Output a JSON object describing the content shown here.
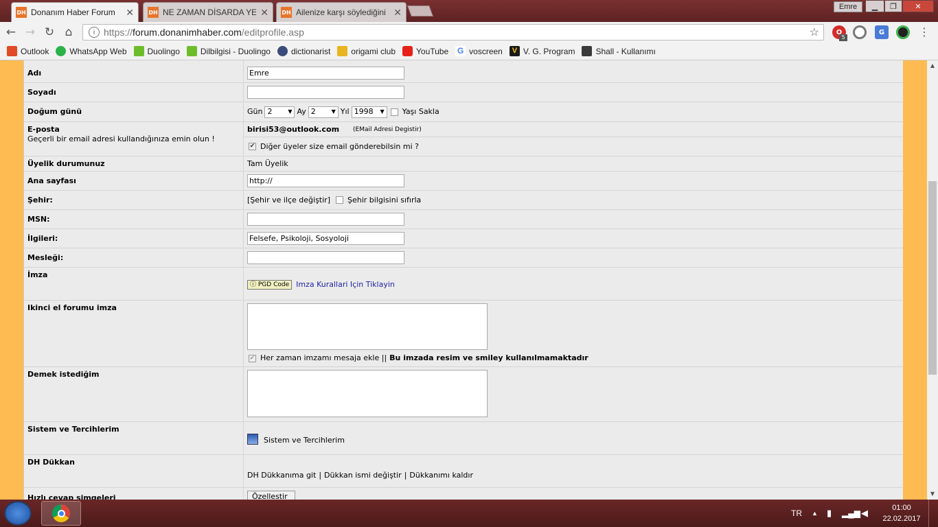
{
  "browser": {
    "tabs": [
      {
        "favicon": "DH",
        "title": "Donanım Haber Forum",
        "active": true
      },
      {
        "favicon": "DH",
        "title": "NE ZAMAN DİSARDA YE",
        "active": false
      },
      {
        "favicon": "DH",
        "title": "Ailenize karşı söylediğini",
        "active": false
      }
    ],
    "user_button": "Emre",
    "url": {
      "scheme": "https://",
      "host": "forum.donanimhaber.com",
      "path": "/editprofile.asp"
    },
    "extension_badge": "5",
    "bookmarks": [
      {
        "label": "Outlook",
        "icon": "windows-logo-icon",
        "color": "#e04a26"
      },
      {
        "label": "WhatsApp Web",
        "icon": "whatsapp-icon",
        "color": "#2bb34a"
      },
      {
        "label": "Duolingo",
        "icon": "duolingo-owl-icon",
        "color": "#6dbd2b"
      },
      {
        "label": "Dilbilgisi - Duolingo",
        "icon": "duolingo-owl-icon",
        "color": "#6dbd2b"
      },
      {
        "label": "dictionarist",
        "icon": "dictionarist-icon",
        "color": "#3b4c7a"
      },
      {
        "label": "origami club",
        "icon": "origami-crane-icon",
        "color": "#e8b520"
      },
      {
        "label": "YouTube",
        "icon": "youtube-icon",
        "color": "#e62117"
      },
      {
        "label": "voscreen",
        "icon": "google-g-icon",
        "color": "#4285f4"
      },
      {
        "label": "V. G. Program",
        "icon": "vg-program-icon",
        "color": "#1a1a1a"
      },
      {
        "label": "Shall - Kullanımı",
        "icon": "shall-page-icon",
        "color": "#3a3a3a"
      }
    ]
  },
  "form": {
    "name": {
      "label": "Adı",
      "value": "Emre"
    },
    "surname": {
      "label": "Soyadı",
      "value": ""
    },
    "birthday": {
      "label": "Doğum günü",
      "day_label": "Gün",
      "day": "2",
      "month_label": "Ay",
      "month": "2",
      "year_label": "Yıl",
      "year": "1998",
      "hide_age_label": "Yaşı Sakla",
      "hide_age_checked": false
    },
    "email": {
      "label": "E-posta",
      "sublabel": "Geçerli bir email adresi kullandığınıza emin olun !",
      "value": "birisi53@outlook.com",
      "change_link": "(EMail Adresi Degistir)",
      "allow_label": "Diğer üyeler size email gönderebilsin mi ?",
      "allow_checked": true
    },
    "membership": {
      "label": "Üyelik durumunuz",
      "value": "Tam Üyelik"
    },
    "homepage": {
      "label": "Ana sayfası",
      "value": "http://"
    },
    "city": {
      "label": "Şehir:",
      "change_link": "[Şehir ve ilçe değiştir]",
      "reset_label": "Şehir bilgisini sıfırla",
      "reset_checked": false
    },
    "msn": {
      "label": "MSN:",
      "value": ""
    },
    "interests": {
      "label": "İlgileri:",
      "value": "Felsefe, Psikoloji, Sosyoloji"
    },
    "occupation": {
      "label": "Mesleği:",
      "value": ""
    },
    "signature": {
      "label": "İmza",
      "pgd_button": "PGD Code",
      "rules_link": "Imza Kurallari Için Tiklayin"
    },
    "second_hand_signature": {
      "label": "Ikinci el forumu imza",
      "always_add_label": "Her zaman imzamı mesaja ekle ||",
      "note": "Bu imzada resim ve smiley kullanılmamaktadır",
      "always_add_checked": true
    },
    "motto": {
      "label": "Demek istediğim"
    },
    "system": {
      "label": "Sistem ve Tercihlerim",
      "link": "Sistem ve Tercihlerim"
    },
    "shop": {
      "label": "DH Dükkan",
      "link_go": "DH Dükkanıma git",
      "sep1": "|",
      "link_rename": "Dükkan ismi değiştir",
      "sep2": "|",
      "link_remove": "Dükkanımı kaldır"
    },
    "quick_reply": {
      "label": "Hızlı cevap simgeleri",
      "button": "Özellestir"
    }
  },
  "taskbar": {
    "language": "TR",
    "time": "01:00",
    "date": "22.02.2017"
  }
}
